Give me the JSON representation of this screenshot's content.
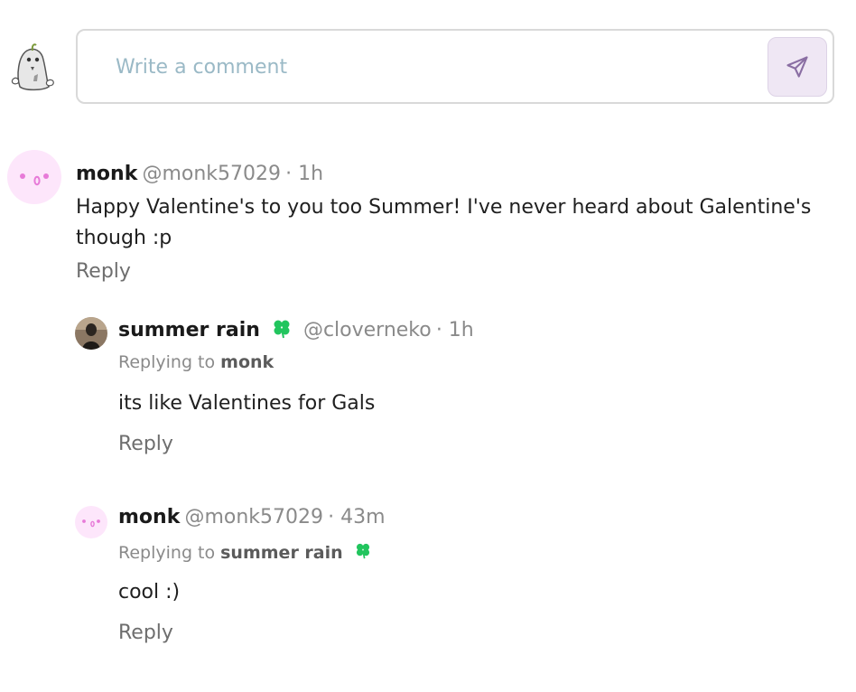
{
  "composer": {
    "placeholder": "Write a comment",
    "send_icon": "send-icon",
    "avatar_icon": "ghost-avatar"
  },
  "comments": [
    {
      "name": "monk",
      "handle": "@monk57029",
      "time": "· 1h",
      "text": "Happy Valentine's to you too Summer! I've never heard about Galentine's though :p",
      "reply_label": "Reply"
    },
    {
      "name": "summer rain",
      "badge_icon": "clover-icon",
      "handle": "@cloverneko",
      "time": "· 1h",
      "replying_prefix": "Replying to",
      "replying_to": "monk",
      "text": "its like Valentines for Gals",
      "reply_label": "Reply"
    },
    {
      "name": "monk",
      "handle": "@monk57029",
      "time": "· 43m",
      "replying_prefix": "Replying to",
      "replying_to": "summer rain",
      "replying_badge_icon": "clover-icon",
      "text": "cool :)",
      "reply_label": "Reply"
    }
  ],
  "colors": {
    "placeholder": "#9ab9c6",
    "send_button_bg": "#efe7f4",
    "send_icon": "#8a6ea3",
    "monk_avatar_bg": "#fde6fb",
    "monk_face": "#e77ad8",
    "clover": "#22c55e"
  }
}
